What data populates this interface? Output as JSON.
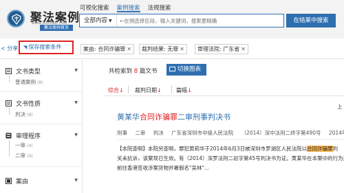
{
  "header": {
    "brand": "聚法案例",
    "brand_url": "WWW.JUFAANLI.COM",
    "brand_home": "聚法案例首页",
    "tabs": [
      {
        "label": "可视化搜索"
      },
      {
        "label": "案例搜索"
      },
      {
        "label": "法规搜索"
      }
    ],
    "search": {
      "scope": "全部内容",
      "placeholder": "←在侧选择区段，输入关键词，搜索更精确"
    },
    "search_in_results": "在结果中搜索"
  },
  "filters": {
    "share": "分享",
    "save_condition": "保存搜索条件",
    "tags": [
      {
        "label": "案由: 合同诈骗罪"
      },
      {
        "label": "裁判结果: 无罪"
      },
      {
        "label": "审理法院: 广东省"
      }
    ]
  },
  "sidebar": {
    "groups": [
      {
        "title": "文书类型",
        "items": [
          {
            "label": "普通案例",
            "count": "(8)"
          }
        ]
      },
      {
        "title": "文书性质",
        "items": [
          {
            "label": "判决",
            "count": "(8)"
          }
        ]
      },
      {
        "title": "审理程序",
        "items": [
          {
            "label": "一审",
            "count": "(4)"
          },
          {
            "label": "二审",
            "count": "(4)"
          }
        ]
      },
      {
        "title": "案由",
        "items": []
      }
    ]
  },
  "results": {
    "count_prefix": "共检索到",
    "count": "8",
    "count_suffix": "篇文书",
    "switch_chart": "切换图表",
    "sort": [
      {
        "label": "综合",
        "arrow": "↓"
      },
      {
        "label": "裁判日期",
        "arrow": "↓"
      },
      {
        "label": "篇幅",
        "arrow": "↓"
      }
    ],
    "top_link": "上",
    "case": {
      "title_before": "黄某华",
      "title_hl": "合同诈骗罪",
      "title_after": "二审刑事判决书",
      "meta": [
        "刑事",
        "二审",
        "判决",
        "广东省深圳市中级人民法院",
        "（2014）深中法刑二终字第490号",
        "2014年12"
      ],
      "body_line1_before": "【本院查明】本院另查明，罪犯黄莉华于2014年6月3日被深圳市罗湖区人民法院以",
      "body_line1_hl": "合同诈骗罪",
      "body_line1_after": "判",
      "body_line2": "关未抗诉，该案现已生效。有（2014）深罗法刑二初字第45号判决书为证。黄某华在本案中的行为是",
      "body_line3": "前往香港签收涉案货物并署假名\"吴林\"..."
    }
  },
  "colors": {
    "accent": "#2f6fb0",
    "highlight_text": "#e02020",
    "highlight_bg": "#f7b34a",
    "save_border": "#e02020"
  }
}
